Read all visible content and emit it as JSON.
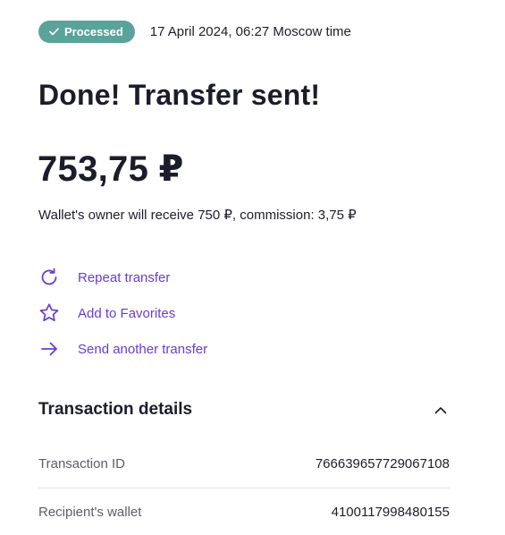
{
  "status": {
    "badge_label": "Processed",
    "timestamp": "17 April 2024, 06:27 Moscow time",
    "badge_color": "#5aa39a"
  },
  "headline": "Done! Transfer sent!",
  "amount": "753,75 ₽",
  "subtext": "Wallet's owner will receive 750 ₽, commission: 3,75 ₽",
  "actions": [
    {
      "label": "Repeat transfer",
      "icon": "repeat-icon"
    },
    {
      "label": "Add to Favorites",
      "icon": "star-icon"
    },
    {
      "label": "Send another transfer",
      "icon": "arrow-right-icon"
    }
  ],
  "accent_color": "#6b3ccf",
  "details": {
    "title": "Transaction details",
    "rows": [
      {
        "key": "Transaction ID",
        "value": "766639657729067108"
      },
      {
        "key": "Recipient's wallet",
        "value": "4100117998480155"
      }
    ]
  }
}
